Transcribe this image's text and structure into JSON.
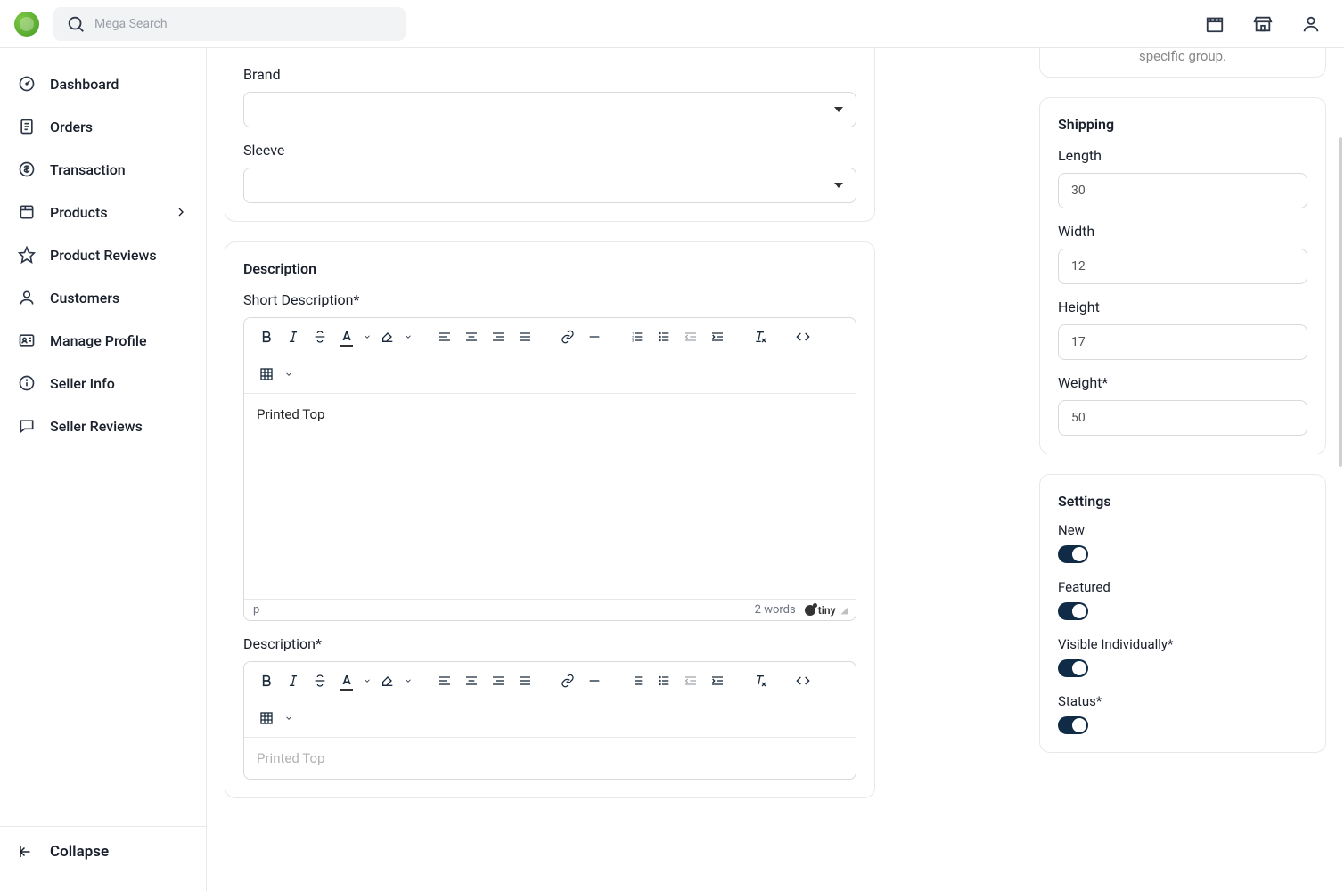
{
  "header": {
    "search_placeholder": "Mega Search"
  },
  "sidebar": {
    "items": [
      {
        "label": "Dashboard",
        "icon": "gauge-icon",
        "expandable": false
      },
      {
        "label": "Orders",
        "icon": "receipt-icon",
        "expandable": false
      },
      {
        "label": "Transaction",
        "icon": "dollar-icon",
        "expandable": false
      },
      {
        "label": "Products",
        "icon": "box-icon",
        "expandable": true
      },
      {
        "label": "Product Reviews",
        "icon": "star-icon",
        "expandable": false
      },
      {
        "label": "Customers",
        "icon": "user-icon",
        "expandable": false
      },
      {
        "label": "Manage Profile",
        "icon": "id-icon",
        "expandable": false
      },
      {
        "label": "Seller Info",
        "icon": "info-icon",
        "expandable": false
      },
      {
        "label": "Seller Reviews",
        "icon": "chat-icon",
        "expandable": false
      }
    ],
    "collapse_label": "Collapse"
  },
  "main": {
    "group_hint_fragment": "specific group.",
    "brand_label": "Brand",
    "brand_value": "",
    "sleeve_label": "Sleeve",
    "sleeve_value": "",
    "description_title": "Description",
    "short_desc_label": "Short Description*",
    "short_desc_content": "Printed Top",
    "short_desc_path": "p",
    "short_desc_wordcount": "2 words",
    "desc_label": "Description*",
    "desc_content": "Printed Top"
  },
  "shipping": {
    "title": "Shipping",
    "length_label": "Length",
    "length_value": "30",
    "width_label": "Width",
    "width_value": "12",
    "height_label": "Height",
    "height_value": "17",
    "weight_label": "Weight*",
    "weight_value": "50"
  },
  "settings": {
    "title": "Settings",
    "new_label": "New",
    "new_on": true,
    "featured_label": "Featured",
    "featured_on": true,
    "visible_label": "Visible Individually*",
    "visible_on": true,
    "status_label": "Status*",
    "status_on": true
  }
}
